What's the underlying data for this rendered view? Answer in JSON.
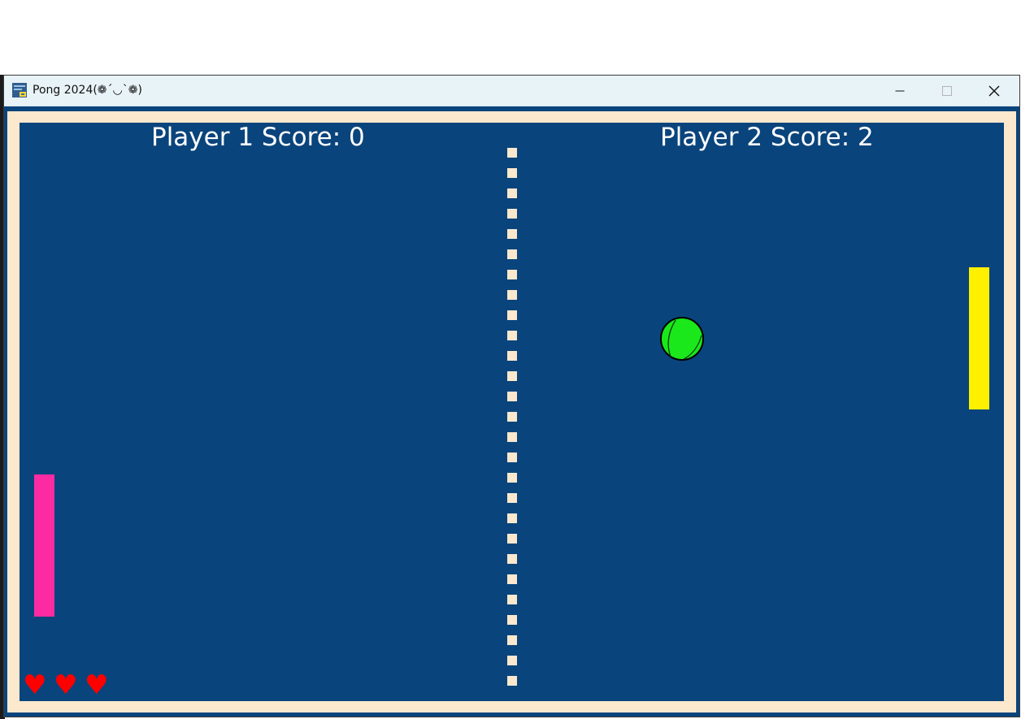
{
  "window": {
    "title": "Pong 2024(❁´◡`❁)",
    "icon": "python-app-icon"
  },
  "controls": {
    "minimize_icon": "minimize-icon",
    "maximize_icon": "maximize-icon",
    "close_icon": "close-icon"
  },
  "game": {
    "player1_score_label": "Player 1 Score: 0",
    "player2_score_label": "Player 2 Score: 2",
    "player1_score": 0,
    "player2_score": 2,
    "lives_remaining": 3,
    "heart_glyph": "♥",
    "colors": {
      "court": "#0a447c",
      "border": "#fbe8cd",
      "left_paddle": "#fd2ba2",
      "right_paddle": "#fff000",
      "ball": "#1ae81a",
      "heart": "#ff0000",
      "net": "#fbe8cd"
    }
  }
}
